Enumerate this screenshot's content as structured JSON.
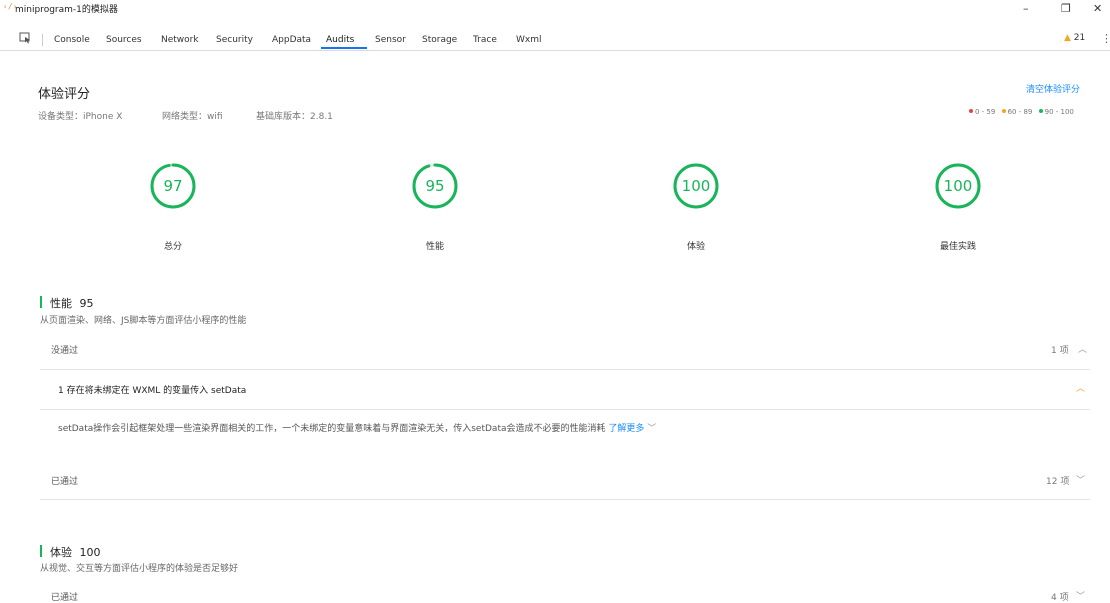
{
  "window": {
    "icon": "‹/›",
    "title": "miniprogram-1的模拟器",
    "controls": {
      "minimize": "–",
      "restore": "❐",
      "close": "✕"
    }
  },
  "devtools": {
    "tabs": [
      "Console",
      "Sources",
      "Network",
      "Security",
      "AppData",
      "Audits",
      "Sensor",
      "Storage",
      "Trace",
      "Wxml"
    ],
    "active_tab": "Audits",
    "warnings": {
      "icon": "▲",
      "count": "21"
    },
    "menu_icon": "⋮"
  },
  "header": {
    "title": "体验评分",
    "clear_link": "清空体验评分",
    "device": "设备类型：iPhone X",
    "network": "网络类型：wifi",
    "lib": "基础库版本：2.8.1",
    "legend": [
      "0 - 59",
      "60 - 89",
      "90 - 100"
    ],
    "legend_colors": [
      "#e64340",
      "#f5a623",
      "#18b55a"
    ]
  },
  "scores": [
    {
      "value": "97",
      "label": "总分",
      "fraction": 0.97
    },
    {
      "value": "95",
      "label": "性能",
      "fraction": 0.95
    },
    {
      "value": "100",
      "label": "体验",
      "fraction": 1.0
    },
    {
      "value": "100",
      "label": "最佳实践",
      "fraction": 1.0
    }
  ],
  "score_color": "#18b55a",
  "performance": {
    "title": "性能",
    "score": "95",
    "desc": "从页面渲染、网络、JS脚本等方面评估小程序的性能",
    "failed_label": "没通过",
    "failed_count": "1 项",
    "issue_title": "1 存在将未绑定在 WXML 的变量传入 setData",
    "issue_desc": "setData操作会引起框架处理一些渲染界面相关的工作，一个未绑定的变量意味着与界面渲染无关，传入setData会造成不必要的性能消耗",
    "learn_more": "了解更多",
    "passed_label": "已通过",
    "passed_count": "12 项"
  },
  "experience": {
    "title": "体验",
    "score": "100",
    "desc": "从视觉、交互等方面评估小程序的体验是否足够好",
    "passed_label": "已通过",
    "passed_count": "4 项"
  }
}
